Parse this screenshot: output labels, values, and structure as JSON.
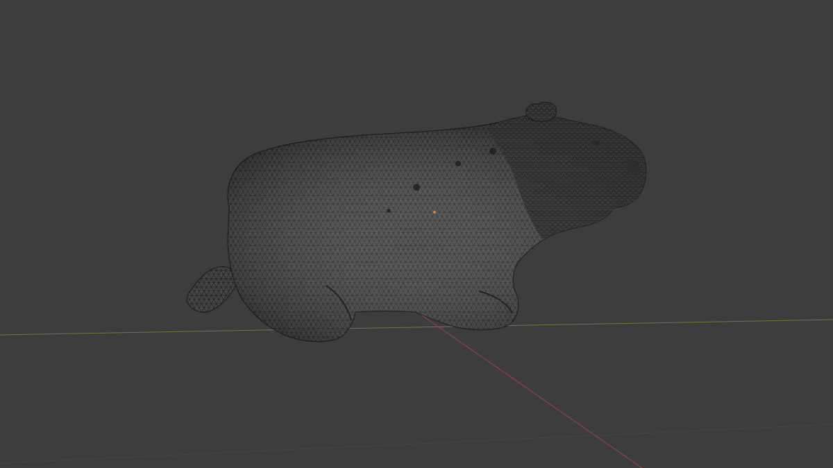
{
  "viewport": {
    "background": "#3d3d3d",
    "mode": "wireframe",
    "object": "capybara-mesh"
  },
  "colors": {
    "mesh_fill": "#4a4a4a",
    "mesh_dark": "#2b2b2b",
    "mesh_line": "#1e1e1e",
    "x_axis": "#a4414b",
    "y_axis": "#6f7a3c",
    "grid": "#474747",
    "origin": "#d08a3a"
  }
}
